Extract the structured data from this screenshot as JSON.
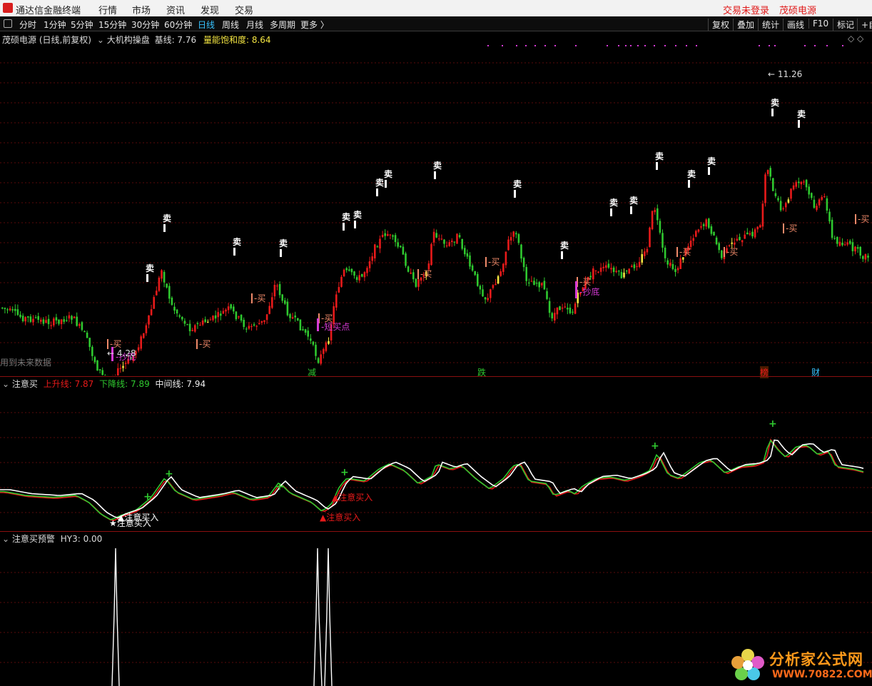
{
  "app": {
    "title": "通达信金融终端",
    "menu": [
      "行情",
      "市场",
      "资讯",
      "发现",
      "交易"
    ],
    "login_status": "交易未登录",
    "stock_name": "茂硕电源"
  },
  "periods": {
    "items": [
      "分时",
      "1分钟",
      "5分钟",
      "15分钟",
      "30分钟",
      "60分钟",
      "日线",
      "周线",
      "月线",
      "多周期",
      "更多 〉"
    ],
    "active": "日线"
  },
  "tools": [
    "复权",
    "叠加",
    "统计",
    "画线",
    "F10",
    "标记",
    "+自"
  ],
  "main_panel": {
    "stock_label": "茂硕电源 (日线,前复权)",
    "indicator_name": "大机构操盘",
    "base_label": "基线: 7.76",
    "saturation_label": "量能饱和度: 8.64",
    "high_label": "11.26",
    "low_label": "4.28",
    "future_data_note": "用到未来数据",
    "sell_label": "卖",
    "buy_label": "买",
    "short_buy_label": "短买点",
    "bottom_label": "抄底",
    "events": [
      "减",
      "跌",
      "榜",
      "财"
    ]
  },
  "sub_panel1": {
    "name": "注意买",
    "up_line": "上升线: 7.87",
    "down_line": "下降线: 7.89",
    "mid_line": "中间线: 7.94",
    "signal_label": "注意买入"
  },
  "sub_panel2": {
    "name": "注意买预警",
    "value": "HY3: 0.00"
  },
  "watermark": {
    "text": "分析家公式网",
    "url": "WWW.70822.COM"
  },
  "colors": {
    "up": "#e81a1a",
    "down": "#2fc82f",
    "yellow": "#f5e642",
    "buy_tag": "#f08a6a",
    "magenta": "#d63ad6",
    "grid": "#5a0a0a"
  }
}
